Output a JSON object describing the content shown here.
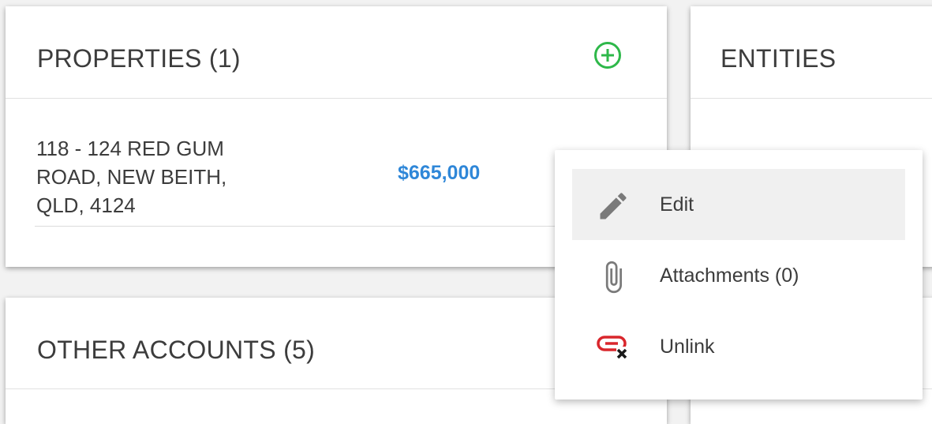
{
  "properties": {
    "title": "PROPERTIES (1)",
    "items": [
      {
        "address": "118 - 124 RED GUM ROAD, NEW BEITH, QLD, 4124",
        "value": "$665,000"
      }
    ]
  },
  "entities": {
    "title": "ENTITIES"
  },
  "other_accounts": {
    "title": "OTHER ACCOUNTS (5)"
  },
  "context_menu": {
    "items": [
      {
        "label": "Edit",
        "icon": "pencil-icon",
        "active": true
      },
      {
        "label": "Attachments (0)",
        "icon": "paperclip-icon",
        "active": false
      },
      {
        "label": "Unlink",
        "icon": "unlink-icon",
        "active": false
      }
    ]
  },
  "colors": {
    "accent_blue": "#2f87d8",
    "add_green": "#2eb84a",
    "unlink_red": "#d9262c"
  }
}
